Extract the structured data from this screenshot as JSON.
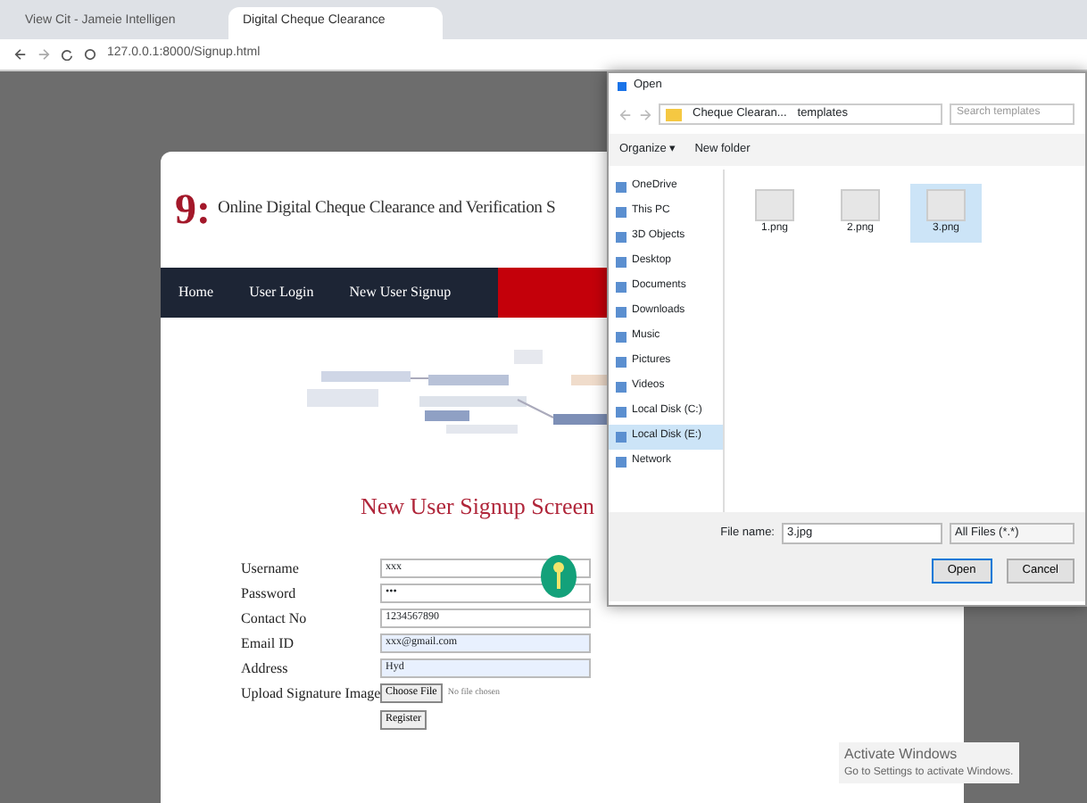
{
  "browser": {
    "tabs": [
      {
        "label": "View Cit - Jameie Intelligen",
        "selected": false
      },
      {
        "label": "Digital Cheque Clearance",
        "selected": true
      }
    ],
    "address": "127.0.0.1:8000/Signup.html"
  },
  "site": {
    "logo": "9:",
    "title": "Online Digital Cheque Clearance and Verification S"
  },
  "nav": [
    {
      "label": "Home"
    },
    {
      "label": "User Login"
    },
    {
      "label": "New User Signup"
    }
  ],
  "form": {
    "heading": "New User Signup Screen",
    "fields": [
      {
        "label": "Username",
        "value": "xxx",
        "kind": "text",
        "autofill": false
      },
      {
        "label": "Password",
        "value": "•••",
        "kind": "text",
        "autofill": false
      },
      {
        "label": "Contact No",
        "value": "1234567890",
        "kind": "text",
        "autofill": false
      },
      {
        "label": "Email ID",
        "value": "xxx@gmail.com",
        "kind": "text",
        "autofill": true
      },
      {
        "label": "Address",
        "value": "Hyd",
        "kind": "text",
        "autofill": true
      },
      {
        "label": "Upload Signature Image",
        "button": "Choose File",
        "note": "No file chosen",
        "kind": "file"
      }
    ],
    "submit": "Register"
  },
  "dialog": {
    "title": "Open",
    "path": [
      {
        "label": "Cheque Clearan..."
      },
      {
        "label": "templates"
      }
    ],
    "search_placeholder": "Search templates",
    "toolbar": [
      "Organize ▾",
      "New folder"
    ],
    "sidebar": [
      {
        "label": "OneDrive",
        "selected": false
      },
      {
        "label": "This PC",
        "selected": false
      },
      {
        "label": "3D Objects",
        "selected": false
      },
      {
        "label": "Desktop",
        "selected": false
      },
      {
        "label": "Documents",
        "selected": false
      },
      {
        "label": "Downloads",
        "selected": false
      },
      {
        "label": "Music",
        "selected": false
      },
      {
        "label": "Pictures",
        "selected": false
      },
      {
        "label": "Videos",
        "selected": false
      },
      {
        "label": "Local Disk (C:)",
        "selected": false
      },
      {
        "label": "Local Disk (E:)",
        "selected": true
      },
      {
        "label": "Network",
        "selected": false
      }
    ],
    "files": [
      {
        "name": "1.png",
        "selected": false
      },
      {
        "name": "2.png",
        "selected": false
      },
      {
        "name": "3.png",
        "selected": true
      }
    ],
    "file_name_label": "File name:",
    "file_name": "3.jpg",
    "file_type": "All Files (*.*)",
    "buttons": [
      "Open",
      "Cancel"
    ]
  },
  "watermark_os": [
    "Activate Windows",
    "Go to Settings to activate Windows."
  ]
}
